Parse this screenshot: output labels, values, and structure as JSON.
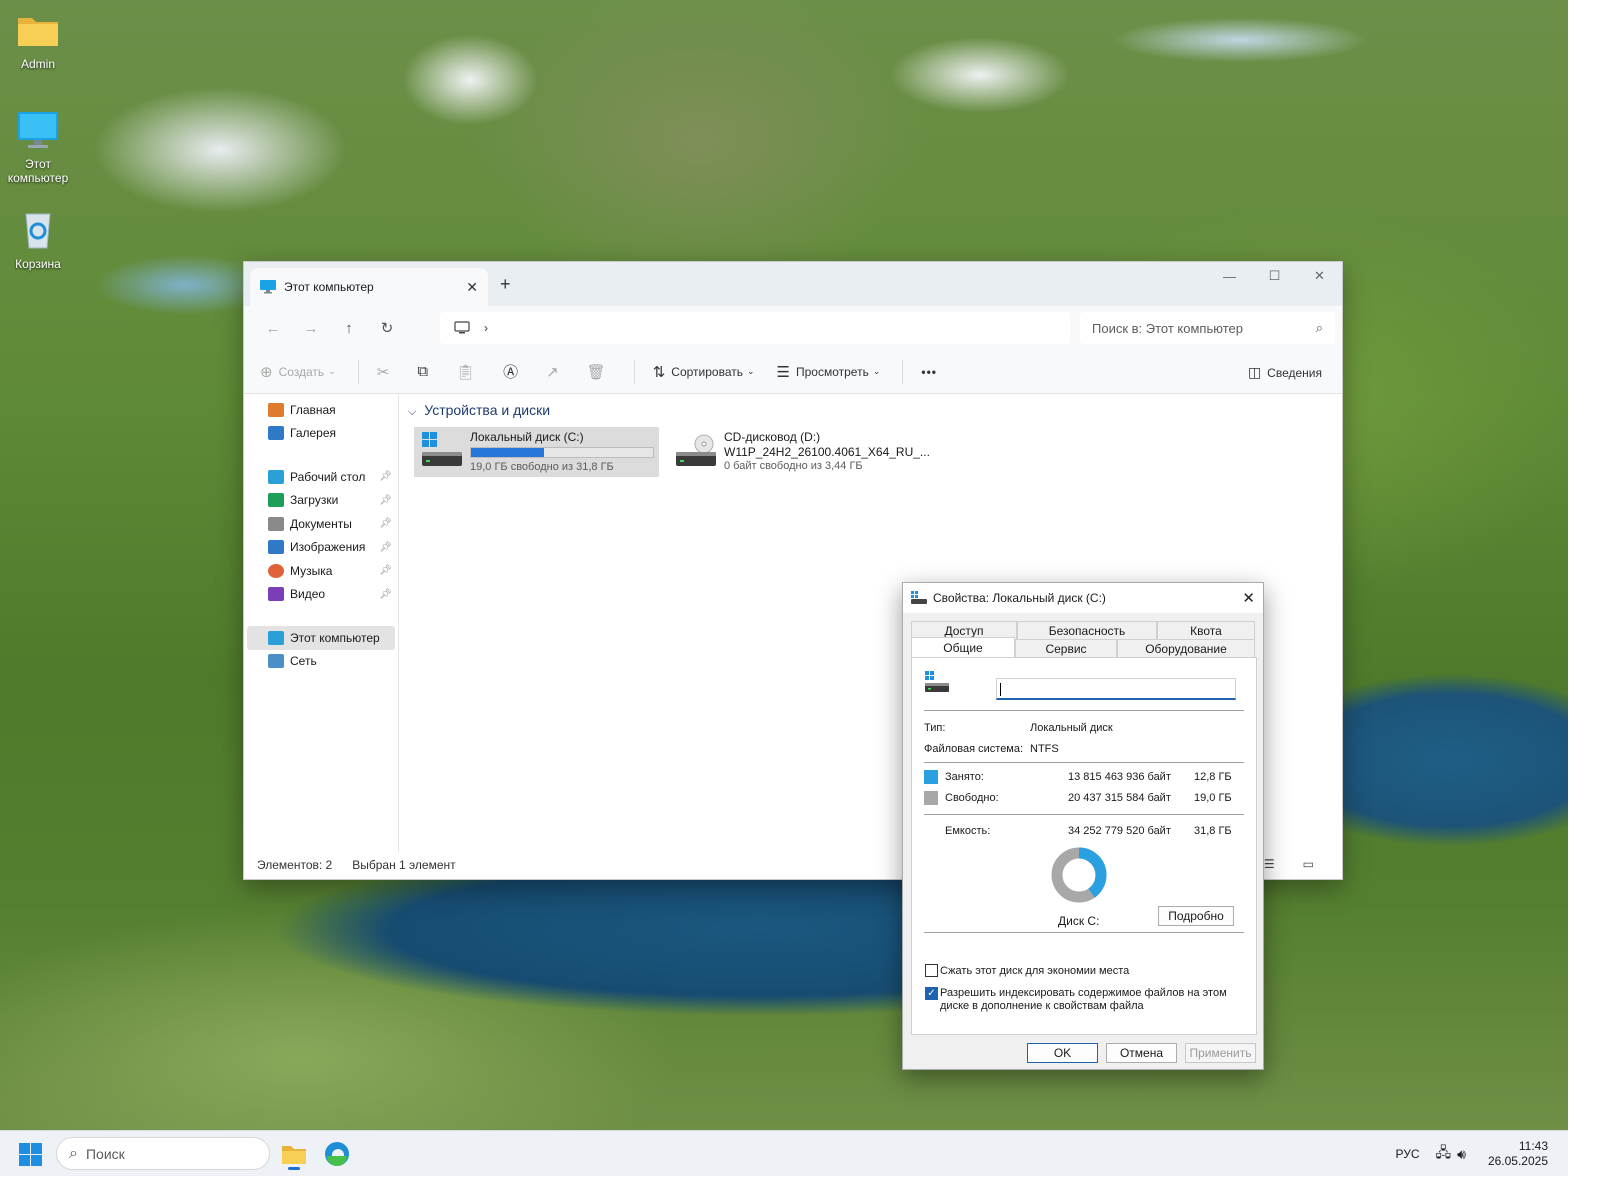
{
  "desktop": {
    "icons": [
      {
        "label": "Admin",
        "icon": "folder-icon"
      },
      {
        "label": "Этот компьютер",
        "icon": "monitor-icon"
      },
      {
        "label": "Корзина",
        "icon": "recycle-bin-icon"
      }
    ]
  },
  "explorer": {
    "tab_title": "Этот компьютер",
    "search_placeholder": "Поиск в: Этот компьютер",
    "toolbar": {
      "create": "Создать",
      "sort": "Сортировать",
      "view": "Просмотреть",
      "more": "•••",
      "details": "Сведения"
    },
    "sidebar": {
      "items": [
        {
          "label": "Главная",
          "color": "#e07a2e"
        },
        {
          "label": "Галерея",
          "color": "#2f79c8"
        },
        {
          "label": "Рабочий стол",
          "color": "#2a9fd8"
        },
        {
          "label": "Загрузки",
          "color": "#1e9e5a"
        },
        {
          "label": "Документы",
          "color": "#8a8a8a"
        },
        {
          "label": "Изображения",
          "color": "#2f79c8"
        },
        {
          "label": "Музыка",
          "color": "#e0603a"
        },
        {
          "label": "Видео",
          "color": "#7a3fb8"
        },
        {
          "label": "Этот компьютер",
          "color": "#2a9fd8"
        },
        {
          "label": "Сеть",
          "color": "#4a8fc8"
        }
      ]
    },
    "group_header": "Устройства и диски",
    "drives": [
      {
        "name": "Локальный диск (C:)",
        "used_fraction": 0.4,
        "sub": "19,0 ГБ свободно из 31,8 ГБ"
      },
      {
        "name": "CD-дисковод (D:)",
        "label": "W11P_24H2_26100.4061_X64_RU_...",
        "sub": "0 байт свободно из 3,44 ГБ"
      }
    ],
    "status": {
      "items": "Элементов: 2",
      "selected": "Выбран 1 элемент"
    }
  },
  "dialog": {
    "title": "Свойства: Локальный диск (C:)",
    "tabs_row1": [
      "Доступ",
      "Безопасность",
      "Квота"
    ],
    "tabs_row2": [
      "Общие",
      "Сервис",
      "Оборудование"
    ],
    "type_label": "Тип:",
    "type_value": "Локальный диск",
    "fs_label": "Файловая система:",
    "fs_value": "NTFS",
    "used_label": "Занято:",
    "used_bytes": "13 815 463 936 байт",
    "used_gb": "12,8 ГБ",
    "free_label": "Свободно:",
    "free_bytes": "20 437 315 584 байт",
    "free_gb": "19,0 ГБ",
    "cap_label": "Емкость:",
    "cap_bytes": "34 252 779 520 байт",
    "cap_gb": "31,8 ГБ",
    "used_fraction": 0.403,
    "disk_label": "Диск C:",
    "details_btn": "Подробно",
    "compress_label": "Сжать этот диск для экономии места",
    "index_label_1": "Разрешить индексировать содержимое файлов на этом",
    "index_label_2": "диске в дополнение к свойствам файла",
    "ok": "OK",
    "cancel": "Отмена",
    "apply": "Применить",
    "colors": {
      "used": "#2aa0e0",
      "free": "#a8a8a8"
    }
  },
  "taskbar": {
    "search_placeholder": "Поиск",
    "lang": "РУС",
    "time": "11:43",
    "date": "26.05.2025"
  }
}
